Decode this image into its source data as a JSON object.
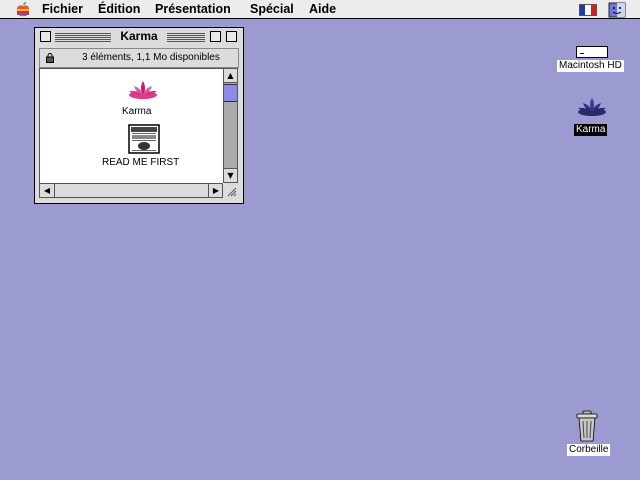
{
  "menubar": {
    "items": [
      "Fichier",
      "Édition",
      "Présentation",
      "Spécial",
      "Aide"
    ]
  },
  "window": {
    "title": "Karma",
    "info": "3 éléments, 1,1  Mo disponibles",
    "files": [
      {
        "label": "Karma",
        "icon": "lotus-icon"
      },
      {
        "label": "READ ME FIRST",
        "icon": "document-icon"
      }
    ]
  },
  "desktop": {
    "hd_label": "Macintosh HD",
    "karma_label": "Karma",
    "trash_label": "Corbeille"
  },
  "colors": {
    "desktop": "#9b9bd2",
    "selection": "#000000",
    "scroll_thumb": "#8c8ce6"
  }
}
